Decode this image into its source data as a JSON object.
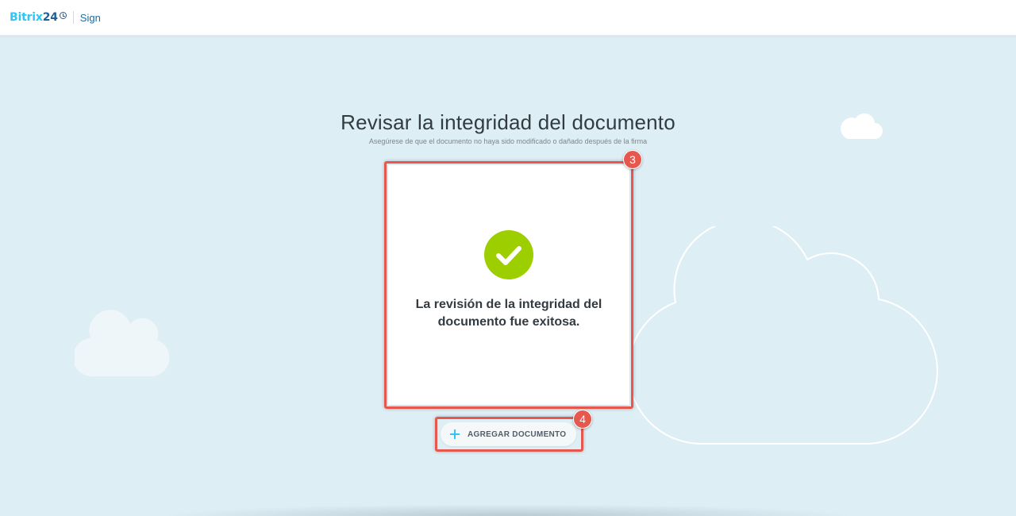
{
  "header": {
    "logo_part1": "Bitrix",
    "logo_part2": "24",
    "product": "Sign"
  },
  "main": {
    "title": "Revisar la integridad del documento",
    "subtitle": "Asegúrese de que el documento no haya sido modificado o dañado después de la firma",
    "result": {
      "icon": "check-icon",
      "message": "La revisión de la integridad del documento fue exitosa."
    },
    "add_button": {
      "icon": "plus-icon",
      "label": "AGREGAR DOCUMENTO"
    }
  },
  "annotations": {
    "step_card": "3",
    "step_button": "4"
  },
  "colors": {
    "background": "#deeef5",
    "brand_light": "#2fc6f6",
    "brand_dark": "#215f98",
    "success": "#9dcf00",
    "annotation": "#e6574d"
  }
}
